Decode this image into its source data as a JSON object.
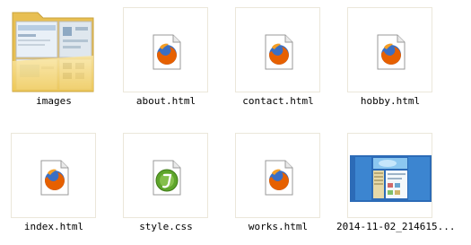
{
  "files": [
    {
      "name": "images",
      "icon": "folder-icon"
    },
    {
      "name": "about.html",
      "icon": "firefox-html-icon"
    },
    {
      "name": "contact.html",
      "icon": "firefox-html-icon"
    },
    {
      "name": "hobby.html",
      "icon": "firefox-html-icon"
    },
    {
      "name": "index.html",
      "icon": "firefox-html-icon"
    },
    {
      "name": "style.css",
      "icon": "dreamweaver-css-icon"
    },
    {
      "name": "works.html",
      "icon": "firefox-html-icon"
    },
    {
      "name": "2014-11-02_214615...",
      "icon": "screenshot-thumbnail"
    }
  ],
  "colors": {
    "folder": "#f3d47a",
    "firefox_orange": "#e66000",
    "firefox_blue": "#3a6fc4",
    "dreamweaver_green": "#5ea52b"
  }
}
